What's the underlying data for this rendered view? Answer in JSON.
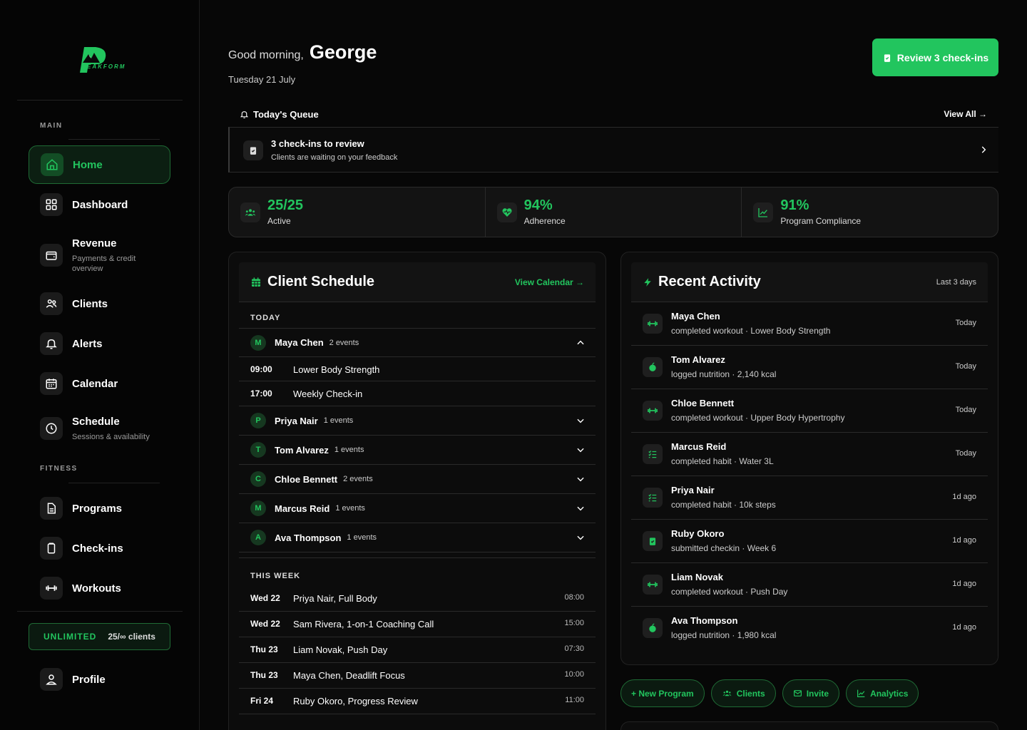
{
  "brand": {
    "wordmark": "EAKFORM"
  },
  "sidebar": {
    "sections": {
      "main": "MAIN",
      "fitness": "FITNESS"
    },
    "items": [
      {
        "label": "Home",
        "sub": ""
      },
      {
        "label": "Dashboard",
        "sub": ""
      },
      {
        "label": "Revenue",
        "sub": "Payments & credit overview"
      },
      {
        "label": "Clients",
        "sub": ""
      },
      {
        "label": "Alerts",
        "sub": ""
      },
      {
        "label": "Calendar",
        "sub": ""
      },
      {
        "label": "Schedule",
        "sub": "Sessions & availability"
      },
      {
        "label": "Programs",
        "sub": ""
      },
      {
        "label": "Check-ins",
        "sub": ""
      },
      {
        "label": "Workouts",
        "sub": ""
      },
      {
        "label": "Profile",
        "sub": ""
      }
    ],
    "plan": {
      "tag": "UNLIMITED",
      "count": "25/∞ clients"
    }
  },
  "header": {
    "greeting": "Good morning,",
    "name": "George",
    "date": "Tuesday 21 July",
    "review_label": "Review 3 check-ins"
  },
  "queue": {
    "title": "Today's Queue",
    "view_all": "View All →",
    "item_title": "3 check-ins to review",
    "item_sub": "Clients are waiting on your feedback"
  },
  "stats": [
    {
      "value": "25/25",
      "label": "Active"
    },
    {
      "value": "94%",
      "label": "Adherence"
    },
    {
      "value": "91%",
      "label": "Program Compliance"
    }
  ],
  "schedule": {
    "title": "Client Schedule",
    "link": "View Calendar →",
    "today_label": "TODAY",
    "week_label": "THIS WEEK",
    "clients": [
      {
        "initial": "M",
        "name": "Maya Chen",
        "events": "2 events"
      },
      {
        "initial": "P",
        "name": "Priya Nair",
        "events": "1 events"
      },
      {
        "initial": "T",
        "name": "Tom Alvarez",
        "events": "1 events"
      },
      {
        "initial": "C",
        "name": "Chloe Bennett",
        "events": "2 events"
      },
      {
        "initial": "M",
        "name": "Marcus Reid",
        "events": "1 events"
      },
      {
        "initial": "A",
        "name": "Ava Thompson",
        "events": "1 events"
      }
    ],
    "expanded": [
      {
        "time": "09:00",
        "name": "Lower Body Strength"
      },
      {
        "time": "17:00",
        "name": "Weekly Check-in"
      }
    ],
    "week": [
      {
        "day": "Wed 22",
        "name": "Priya Nair, Full Body",
        "time": "08:00"
      },
      {
        "day": "Wed 22",
        "name": "Sam Rivera, 1-on-1 Coaching Call",
        "time": "15:00"
      },
      {
        "day": "Thu 23",
        "name": "Liam Novak, Push Day",
        "time": "07:30"
      },
      {
        "day": "Thu 23",
        "name": "Maya Chen, Deadlift Focus",
        "time": "10:00"
      },
      {
        "day": "Fri 24",
        "name": "Ruby Okoro, Progress Review",
        "time": "11:00"
      }
    ]
  },
  "activity": {
    "title": "Recent Activity",
    "range": "Last 3 days",
    "items": [
      {
        "icon": "dumbbell-icon",
        "name": "Maya Chen",
        "desc": "completed workout · Lower Body Strength",
        "when": "Today"
      },
      {
        "icon": "apple-icon",
        "name": "Tom Alvarez",
        "desc": "logged nutrition · 2,140 kcal",
        "when": "Today"
      },
      {
        "icon": "dumbbell-icon",
        "name": "Chloe Bennett",
        "desc": "completed workout · Upper Body Hypertrophy",
        "when": "Today"
      },
      {
        "icon": "habit-list-icon",
        "name": "Marcus Reid",
        "desc": "completed habit · Water 3L",
        "when": "Today"
      },
      {
        "icon": "habit-list-icon",
        "name": "Priya Nair",
        "desc": "completed habit · 10k steps",
        "when": "1d ago"
      },
      {
        "icon": "clipboard-icon",
        "name": "Ruby Okoro",
        "desc": "submitted checkin · Week 6",
        "when": "1d ago"
      },
      {
        "icon": "dumbbell-icon",
        "name": "Liam Novak",
        "desc": "completed workout · Push Day",
        "when": "1d ago"
      },
      {
        "icon": "apple-icon",
        "name": "Ava Thompson",
        "desc": "logged nutrition · 1,980 kcal",
        "when": "1d ago"
      }
    ]
  },
  "quick": [
    "+ New Program",
    "Clients",
    "Invite",
    "Analytics"
  ],
  "colors": {
    "accent": "#22c55e",
    "bg": "#070707",
    "panel": "#0c0c0c"
  }
}
